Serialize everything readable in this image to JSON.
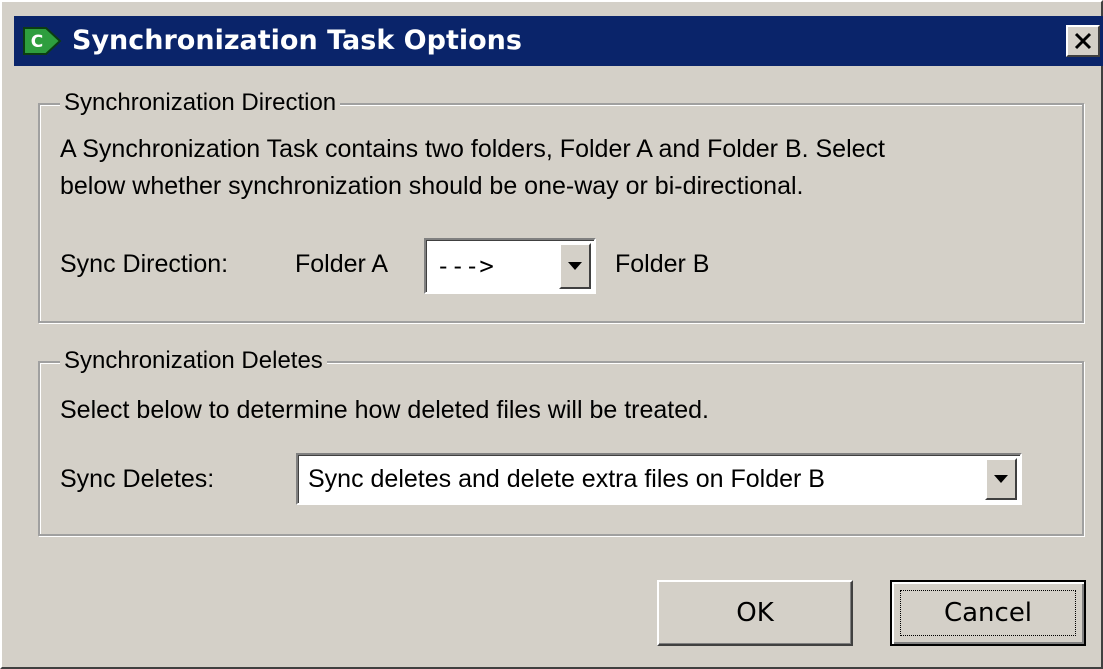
{
  "window": {
    "title": "Synchronization Task Options",
    "close_label": "×",
    "icon": "sync-app-icon",
    "close_icon": "close-icon"
  },
  "direction_group": {
    "title": "Synchronization Direction",
    "description_line1": "A Synchronization Task contains two folders, Folder A and Folder B. Select",
    "description_line2": "below whether synchronization should be one-way or bi-directional.",
    "sync_label": "Sync Direction:",
    "folder_a": "Folder A",
    "folder_b": "Folder B",
    "direction_value": "--->"
  },
  "deletes_group": {
    "title": "Synchronization Deletes",
    "description": "Select below to determine how deleted files will be treated.",
    "sync_label": "Sync Deletes:",
    "deletes_value": "Sync deletes and delete extra files on Folder B"
  },
  "buttons": {
    "ok": "OK",
    "cancel": "Cancel"
  },
  "colors": {
    "titlebar": "#0a246a",
    "dialog_bg": "#d4d0c8",
    "icon_green": "#2e9e3e"
  }
}
